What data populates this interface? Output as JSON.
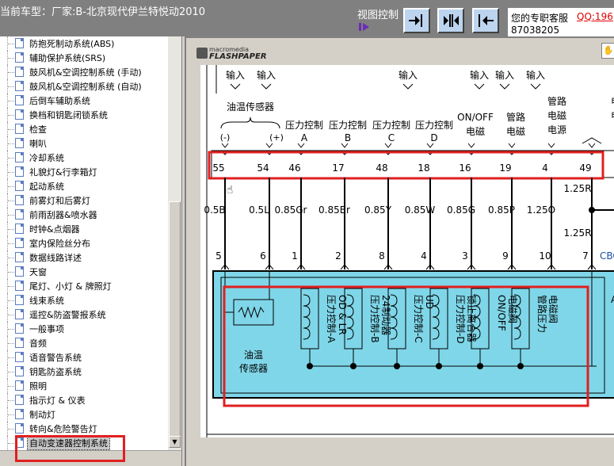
{
  "header": {
    "title": "当前车型：厂家:B-北京现代伊兰特悦动2010",
    "view_control": "视图控制",
    "support_label": "您的专职客服",
    "support_qq": "QQ:196",
    "support_number": "87038205"
  },
  "sidebar": {
    "items": [
      {
        "label": "防抱死制动系统(ABS)"
      },
      {
        "label": "辅助保护系统(SRS)"
      },
      {
        "label": "鼓风机&空调控制系统 (手动)"
      },
      {
        "label": "鼓风机&空调控制系统 (自动)"
      },
      {
        "label": "后倒车辅助系统"
      },
      {
        "label": "换档和钥匙闭锁系统"
      },
      {
        "label": "检查"
      },
      {
        "label": "喇叭"
      },
      {
        "label": "冷却系统"
      },
      {
        "label": "礼貌灯&行李箱灯"
      },
      {
        "label": "起动系统"
      },
      {
        "label": "前雾灯和后雾灯"
      },
      {
        "label": "前雨刮器&喷水器"
      },
      {
        "label": "时钟&点烟器"
      },
      {
        "label": "室内保险丝分布"
      },
      {
        "label": "数据线路详述"
      },
      {
        "label": "天窗"
      },
      {
        "label": "尾灯、小灯 & 牌照灯"
      },
      {
        "label": "线束系统"
      },
      {
        "label": "遥控&防盗警报系统"
      },
      {
        "label": "一般事项"
      },
      {
        "label": "音频"
      },
      {
        "label": "语音警告系统"
      },
      {
        "label": "钥匙防盗系统"
      },
      {
        "label": "照明"
      },
      {
        "label": "指示灯 & 仪表"
      },
      {
        "label": "制动灯"
      },
      {
        "label": "转向&危险警告灯"
      },
      {
        "label": "自动变速器控制系统",
        "selected": true
      }
    ]
  },
  "viewer": {
    "logo_top": "macromedia",
    "logo_bottom": "FLASHPAPER"
  },
  "diagram": {
    "top_labels": [
      "输入",
      "输入",
      "输入",
      "输入",
      "输入",
      "输入"
    ],
    "header_labels": [
      {
        "l1": "油温传感器",
        "l2": ""
      },
      {
        "l1": "压力控制",
        "l2": "A"
      },
      {
        "l1": "压力控制",
        "l2": "B"
      },
      {
        "l1": "压力控制",
        "l2": "C"
      },
      {
        "l1": "压力控制",
        "l2": "D"
      },
      {
        "l1": "ON/OFF",
        "l2": "电磁"
      },
      {
        "l1": "管路",
        "l2": "电磁"
      },
      {
        "l1": "管路",
        "l2": "电磁"
      },
      {
        "l1": "",
        "l2": "电源"
      }
    ],
    "sensor_minus": "(-)",
    "sensor_plus": "(+)",
    "pins_top": [
      "55",
      "54",
      "46",
      "17",
      "48",
      "18",
      "16",
      "19",
      "4",
      "49"
    ],
    "wires": [
      "0.5B",
      "0.5L",
      "0.85Gr",
      "0.85Br",
      "0.85Y",
      "0.85W",
      "0.85G",
      "0.85P",
      "1.25O"
    ],
    "wire_right_top": "1.25R",
    "wire_right_bottom": "1.25R",
    "pins_bottom": [
      "5",
      "6",
      "1",
      "2",
      "8",
      "4",
      "3",
      "9",
      "10",
      "7"
    ],
    "cbg": "CBG",
    "sensor_name": "油温传感器",
    "solenoids": [
      "压力控制-A OD & LR",
      "压力控制-B 24制动器",
      "压力控制-C UD",
      "压力控制-D 锁止离合器",
      "ON/OFF 电磁阀",
      "管路压力 电磁阀"
    ],
    "right_partial_a": "电",
    "right_partial_b": "电",
    "box_right_label": "A"
  },
  "colors": {
    "header_bg": "#808080",
    "highlight_red": "#e02020",
    "ecu_fill": "#7fd6e8",
    "qq_red": "#e00000"
  }
}
